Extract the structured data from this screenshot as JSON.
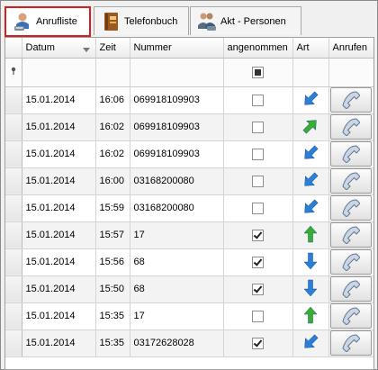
{
  "tabs": [
    {
      "label": "Anrufliste",
      "active": true,
      "icon": "person-phone-icon"
    },
    {
      "label": "Telefonbuch",
      "active": false,
      "icon": "phonebook-icon"
    },
    {
      "label": "Akt - Personen",
      "active": false,
      "icon": "people-phone-icon"
    }
  ],
  "columns": {
    "datum": "Datum",
    "zeit": "Zeit",
    "nummer": "Nummer",
    "angenommen": "angenommen",
    "art": "Art",
    "anrufen": "Anrufen"
  },
  "rows": [
    {
      "datum": "15.01.2014",
      "zeit": "16:06",
      "nummer": "069918109903",
      "angenommen": false,
      "art": "incoming-arrow-icon"
    },
    {
      "datum": "15.01.2014",
      "zeit": "16:02",
      "nummer": "069918109903",
      "angenommen": false,
      "art": "outgoing-arrow-icon"
    },
    {
      "datum": "15.01.2014",
      "zeit": "16:02",
      "nummer": "069918109903",
      "angenommen": false,
      "art": "incoming-arrow-icon"
    },
    {
      "datum": "15.01.2014",
      "zeit": "16:00",
      "nummer": "03168200080",
      "angenommen": false,
      "art": "incoming-arrow-icon"
    },
    {
      "datum": "15.01.2014",
      "zeit": "15:59",
      "nummer": "03168200080",
      "angenommen": false,
      "art": "incoming-arrow-icon"
    },
    {
      "datum": "15.01.2014",
      "zeit": "15:57",
      "nummer": "17",
      "angenommen": true,
      "art": "up-arrow-icon"
    },
    {
      "datum": "15.01.2014",
      "zeit": "15:56",
      "nummer": "68",
      "angenommen": true,
      "art": "down-arrow-icon"
    },
    {
      "datum": "15.01.2014",
      "zeit": "15:50",
      "nummer": "68",
      "angenommen": true,
      "art": "down-arrow-icon"
    },
    {
      "datum": "15.01.2014",
      "zeit": "15:35",
      "nummer": "17",
      "angenommen": false,
      "art": "up-arrow-icon"
    },
    {
      "datum": "15.01.2014",
      "zeit": "15:35",
      "nummer": "03172628028",
      "angenommen": true,
      "art": "incoming-arrow-icon"
    }
  ],
  "colors": {
    "active_tab_border": "#d21f1f",
    "arrow_blue": "#2a7fd8",
    "arrow_green": "#39b02c"
  }
}
